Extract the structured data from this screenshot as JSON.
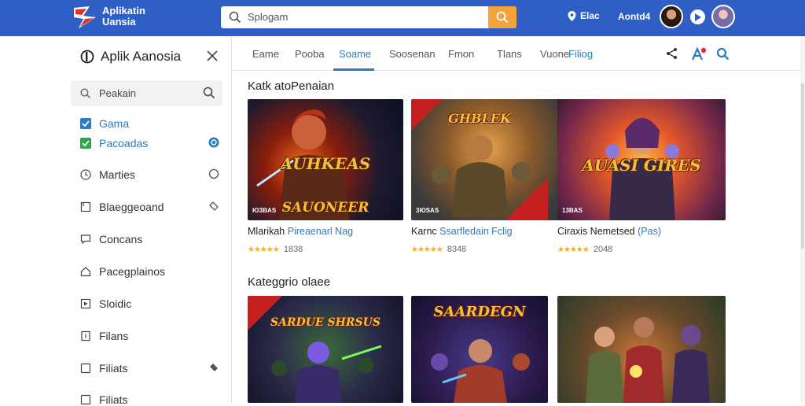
{
  "header": {
    "logo_line1": "Aplikatin",
    "logo_line2": "Uansia",
    "search_placeholder": "Splogam",
    "location_label": "Elac",
    "account_label": "Aontd4"
  },
  "sidebar": {
    "title": "Aplik Aanosia",
    "search_placeholder": "Peakain",
    "items": [
      {
        "label": "Gama",
        "type": "checked"
      },
      {
        "label": "Pacoadas",
        "type": "checked"
      },
      {
        "label": "Marties",
        "type": "icon"
      },
      {
        "label": "Blaeggeoand",
        "type": "icon"
      },
      {
        "label": "Concans",
        "type": "icon"
      },
      {
        "label": "Pacegplainos",
        "type": "icon"
      },
      {
        "label": "Sloidic",
        "type": "icon"
      },
      {
        "label": "Filans",
        "type": "icon"
      },
      {
        "label": "Filiats",
        "type": "checkbox"
      },
      {
        "label": "Filiats",
        "type": "checkbox"
      }
    ]
  },
  "tabs": [
    {
      "label": "Eame",
      "active": false
    },
    {
      "label": "Pooba",
      "active": false
    },
    {
      "label": "Soame",
      "active": true
    },
    {
      "label": "Soosenan",
      "active": false
    },
    {
      "label": "Fmon",
      "active": false
    },
    {
      "label": "Tlans",
      "active": false
    },
    {
      "label": "Vuone",
      "active": false
    },
    {
      "label": "Filiog",
      "active": false
    }
  ],
  "sections": [
    {
      "title": "Katk atoPenaian",
      "cards": [
        {
          "art_caption": "SAUONEER",
          "art_text": "AUHKEAS",
          "tag": "ЮЗBAS",
          "title_prefix": "Mlarikah",
          "title_highlight": "Pireaenarl Nag",
          "rating": "1838"
        },
        {
          "art_caption": "",
          "art_text": "GHBLEK",
          "tag": "3ЮSAS",
          "title_prefix": "Karnc",
          "title_highlight": "Ssarfledain Fclig",
          "rating": "8348"
        },
        {
          "art_caption": "",
          "art_text": "AUASI GIRES",
          "tag": "13BAS",
          "title_prefix": "Ciraxis Nemetsed",
          "title_highlight": "(Pas)",
          "rating": "2048"
        }
      ]
    },
    {
      "title": "Kateggrio olaee",
      "cards": [
        {
          "art_caption": "",
          "art_text": "SARDUE SHRSUS",
          "tag": "",
          "title_prefix": "",
          "title_highlight": "",
          "rating": ""
        },
        {
          "art_caption": "",
          "art_text": "SAARDEGN",
          "tag": "",
          "title_prefix": "",
          "title_highlight": "",
          "rating": ""
        },
        {
          "art_caption": "",
          "art_text": "",
          "tag": "",
          "title_prefix": "",
          "title_highlight": "",
          "rating": ""
        }
      ]
    }
  ],
  "colors": {
    "topbar": "#2f5fc4",
    "accent": "#2a7bbf",
    "search_button": "#f2a33a",
    "star": "#f2b01e"
  }
}
